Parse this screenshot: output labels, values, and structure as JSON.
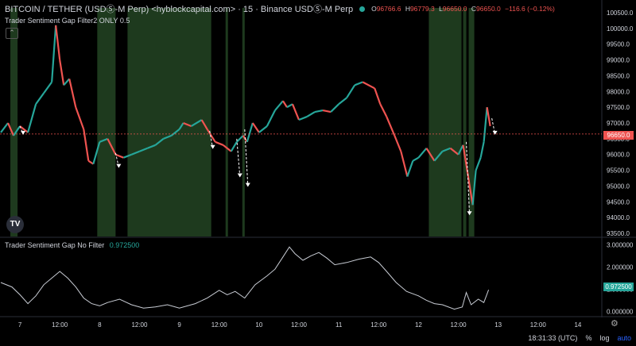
{
  "header": {
    "symbol": "BITCOIN / TETHER (USDⓈ-M Perp) <hyblockcapital.com> · 15 · Binance USDⓈ-M Perp",
    "ohlc": {
      "o_label": "O",
      "o": "96766.6",
      "h_label": "H",
      "h": "96779.3",
      "l_label": "L",
      "l": "96650.0",
      "c_label": "C",
      "c": "96650.0",
      "chg": "−116.6 (−0.12%)"
    }
  },
  "indicator_top": {
    "label": "Trader Sentiment Gap Filter2 ONLY 0.5"
  },
  "indicator_bottom": {
    "label": "Trader Sentiment Gap No Filter",
    "value": "0.972500"
  },
  "logo": {
    "text": "TV"
  },
  "price_tag": "96650.0",
  "indicator_tag": "0.972500",
  "footer": {
    "time": "18:31:33 (UTC)",
    "percent": "%",
    "log": "log",
    "auto": "auto"
  },
  "colors": {
    "up": "#26a69a",
    "down": "#ef5350",
    "shade": "#1e3a1e",
    "line": "#c8ccd4"
  },
  "chart_data": [
    {
      "type": "line",
      "name": "BTCUSDT 15m",
      "x_ticks": [
        "7",
        "12:00",
        "8",
        "12:00",
        "9",
        "12:00",
        "10",
        "12:00",
        "11",
        "12:00",
        "12",
        "12:00",
        "13",
        "12:00",
        "14"
      ],
      "y_ticks": [
        "100500.0",
        "100000.0",
        "99500.0",
        "99000.0",
        "98500.0",
        "98000.0",
        "97500.0",
        "97000.0",
        "96500.0",
        "96000.0",
        "95500.0",
        "95000.0",
        "94500.0",
        "94000.0",
        "93500.0"
      ],
      "ylim": [
        93400,
        100650
      ],
      "x_range_days": [
        6.75,
        14.3
      ],
      "points": [
        [
          6.76,
          96700
        ],
        [
          6.85,
          97000
        ],
        [
          6.92,
          96600
        ],
        [
          7.0,
          96900
        ],
        [
          7.1,
          96700
        ],
        [
          7.2,
          97600
        ],
        [
          7.3,
          97950
        ],
        [
          7.4,
          98300
        ],
        [
          7.45,
          100100
        ],
        [
          7.5,
          99000
        ],
        [
          7.55,
          98200
        ],
        [
          7.62,
          98400
        ],
        [
          7.7,
          97500
        ],
        [
          7.8,
          96800
        ],
        [
          7.86,
          95800
        ],
        [
          7.92,
          95700
        ],
        [
          8.0,
          96400
        ],
        [
          8.1,
          96500
        ],
        [
          8.2,
          96000
        ],
        [
          8.3,
          95900
        ],
        [
          8.4,
          96000
        ],
        [
          8.5,
          96100
        ],
        [
          8.6,
          96200
        ],
        [
          8.7,
          96300
        ],
        [
          8.8,
          96500
        ],
        [
          8.9,
          96600
        ],
        [
          9.0,
          96800
        ],
        [
          9.05,
          97000
        ],
        [
          9.15,
          96900
        ],
        [
          9.28,
          97100
        ],
        [
          9.35,
          96800
        ],
        [
          9.45,
          96400
        ],
        [
          9.55,
          96300
        ],
        [
          9.65,
          96100
        ],
        [
          9.72,
          96400
        ],
        [
          9.8,
          96600
        ],
        [
          9.85,
          96400
        ],
        [
          9.92,
          97000
        ],
        [
          10.0,
          96700
        ],
        [
          10.1,
          96900
        ],
        [
          10.2,
          97400
        ],
        [
          10.3,
          97700
        ],
        [
          10.35,
          97500
        ],
        [
          10.42,
          97600
        ],
        [
          10.5,
          97100
        ],
        [
          10.6,
          97200
        ],
        [
          10.7,
          97350
        ],
        [
          10.8,
          97400
        ],
        [
          10.9,
          97350
        ],
        [
          11.0,
          97600
        ],
        [
          11.1,
          97800
        ],
        [
          11.2,
          98200
        ],
        [
          11.3,
          98300
        ],
        [
          11.45,
          98100
        ],
        [
          11.52,
          97600
        ],
        [
          11.6,
          97200
        ],
        [
          11.7,
          96600
        ],
        [
          11.78,
          96100
        ],
        [
          11.86,
          95300
        ],
        [
          11.93,
          95800
        ],
        [
          12.0,
          95900
        ],
        [
          12.1,
          96200
        ],
        [
          12.2,
          95800
        ],
        [
          12.3,
          96100
        ],
        [
          12.4,
          96200
        ],
        [
          12.5,
          96000
        ],
        [
          12.56,
          96300
        ],
        [
          12.63,
          95200
        ],
        [
          12.68,
          94400
        ],
        [
          12.72,
          95500
        ],
        [
          12.78,
          95900
        ],
        [
          12.82,
          96400
        ],
        [
          12.86,
          97500
        ],
        [
          12.9,
          96900
        ]
      ],
      "shaded_regions_days": [
        [
          6.88,
          6.97
        ],
        [
          7.97,
          8.2
        ],
        [
          8.35,
          9.4
        ],
        [
          9.58,
          9.61
        ],
        [
          9.79,
          9.82
        ],
        [
          12.13,
          12.54
        ],
        [
          12.56,
          12.6
        ],
        [
          12.63,
          12.7
        ]
      ],
      "arrows_days_prices": [
        [
          7.0,
          96900,
          96650
        ],
        [
          8.2,
          96050,
          95600
        ],
        [
          9.38,
          96750,
          96200
        ],
        [
          9.72,
          96500,
          95300
        ],
        [
          9.82,
          96800,
          95000
        ],
        [
          12.6,
          96400,
          94100
        ],
        [
          12.92,
          97150,
          96650
        ]
      ],
      "current_price": 96650.0
    },
    {
      "type": "line",
      "name": "Trader Sentiment Gap No Filter",
      "y_ticks": [
        "3.000000",
        "2.000000",
        "1.000000",
        "0.000000"
      ],
      "ylim": [
        -0.2,
        3.3
      ],
      "points": [
        [
          6.76,
          1.3
        ],
        [
          6.9,
          1.1
        ],
        [
          7.0,
          0.75
        ],
        [
          7.1,
          0.35
        ],
        [
          7.2,
          0.7
        ],
        [
          7.3,
          1.2
        ],
        [
          7.4,
          1.5
        ],
        [
          7.5,
          1.8
        ],
        [
          7.6,
          1.5
        ],
        [
          7.7,
          1.1
        ],
        [
          7.8,
          0.6
        ],
        [
          7.9,
          0.35
        ],
        [
          8.0,
          0.25
        ],
        [
          8.1,
          0.4
        ],
        [
          8.25,
          0.55
        ],
        [
          8.4,
          0.3
        ],
        [
          8.55,
          0.15
        ],
        [
          8.7,
          0.2
        ],
        [
          8.85,
          0.3
        ],
        [
          9.0,
          0.15
        ],
        [
          9.2,
          0.35
        ],
        [
          9.35,
          0.6
        ],
        [
          9.5,
          0.95
        ],
        [
          9.6,
          0.75
        ],
        [
          9.7,
          0.9
        ],
        [
          9.82,
          0.6
        ],
        [
          9.95,
          1.2
        ],
        [
          10.1,
          1.6
        ],
        [
          10.2,
          1.9
        ],
        [
          10.3,
          2.45
        ],
        [
          10.38,
          2.9
        ],
        [
          10.45,
          2.6
        ],
        [
          10.55,
          2.3
        ],
        [
          10.65,
          2.5
        ],
        [
          10.75,
          2.65
        ],
        [
          10.85,
          2.4
        ],
        [
          10.95,
          2.1
        ],
        [
          11.1,
          2.2
        ],
        [
          11.25,
          2.35
        ],
        [
          11.4,
          2.45
        ],
        [
          11.5,
          2.2
        ],
        [
          11.6,
          1.8
        ],
        [
          11.72,
          1.3
        ],
        [
          11.85,
          0.9
        ],
        [
          12.0,
          0.7
        ],
        [
          12.1,
          0.5
        ],
        [
          12.2,
          0.35
        ],
        [
          12.3,
          0.3
        ],
        [
          12.45,
          0.1
        ],
        [
          12.55,
          0.2
        ],
        [
          12.6,
          0.85
        ],
        [
          12.66,
          0.3
        ],
        [
          12.75,
          0.55
        ],
        [
          12.82,
          0.4
        ],
        [
          12.88,
          0.97
        ]
      ],
      "current_value": 0.9725
    }
  ]
}
